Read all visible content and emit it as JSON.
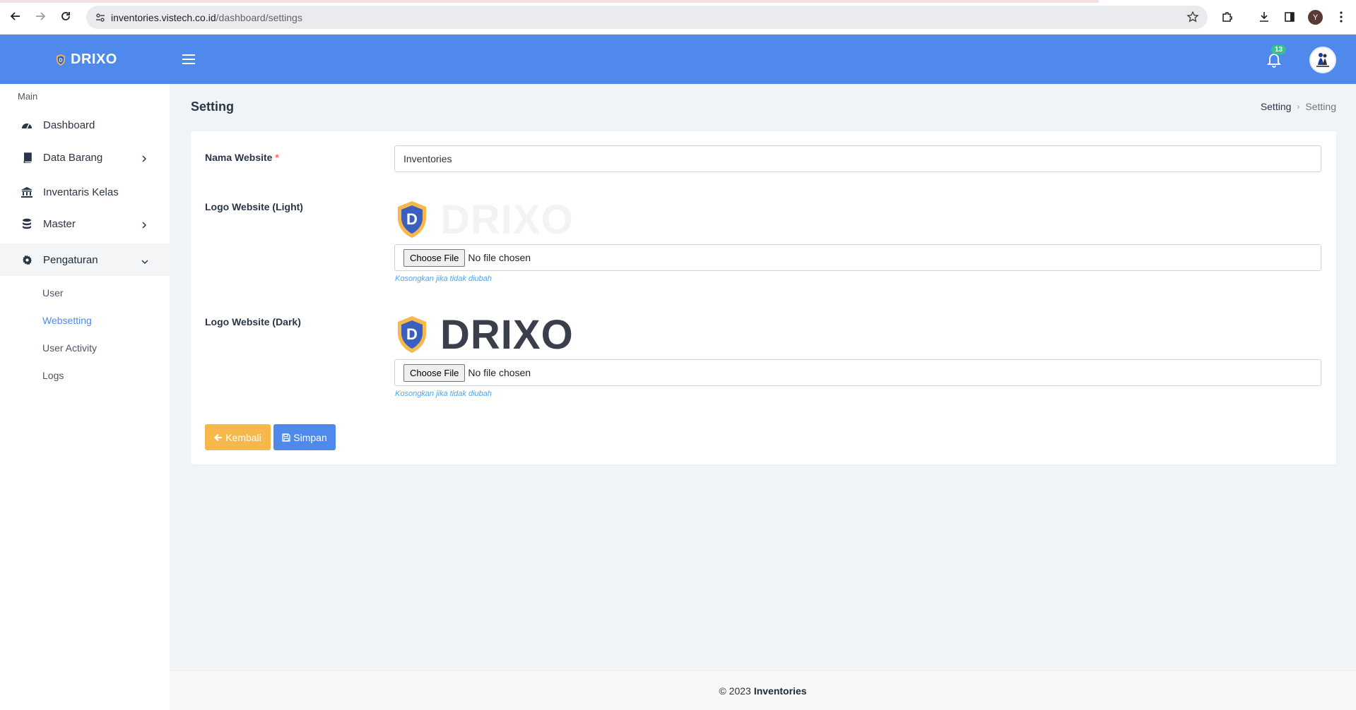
{
  "browser": {
    "url_host": "inventories.vistech.co.id",
    "url_path": "/dashboard/settings",
    "profile_initial": "Y"
  },
  "header": {
    "brand": "DRIXO",
    "notification_count": "13",
    "colors": {
      "primary": "#5089ec",
      "badge": "#34c38f"
    }
  },
  "sidebar": {
    "section_title": "Main",
    "items": [
      {
        "label": "Dashboard",
        "icon": "dashboard-icon"
      },
      {
        "label": "Data Barang",
        "icon": "book-icon"
      },
      {
        "label": "Inventaris Kelas",
        "icon": "institution-icon"
      },
      {
        "label": "Master",
        "icon": "database-icon"
      },
      {
        "label": "Pengaturan",
        "icon": "gear-icon"
      }
    ],
    "submenu": [
      {
        "label": "User"
      },
      {
        "label": "Websetting"
      },
      {
        "label": "User Activity"
      },
      {
        "label": "Logs"
      }
    ]
  },
  "page": {
    "title": "Setting",
    "breadcrumb": [
      "Setting",
      "Setting"
    ]
  },
  "form": {
    "site_name_label": "Nama Website",
    "required_mark": "*",
    "site_name_value": "Inventories",
    "logo_light_label": "Logo Website (Light)",
    "logo_dark_label": "Logo Website (Dark)",
    "logo_word": "DRIXO",
    "choose_file": "Choose File",
    "no_file": "No file chosen",
    "hint": "Kosongkan jika tidak diubah",
    "back_button": "Kembali",
    "save_button": "Simpan"
  },
  "footer": {
    "copyright": "© 2023",
    "app_name": "Inventories"
  }
}
